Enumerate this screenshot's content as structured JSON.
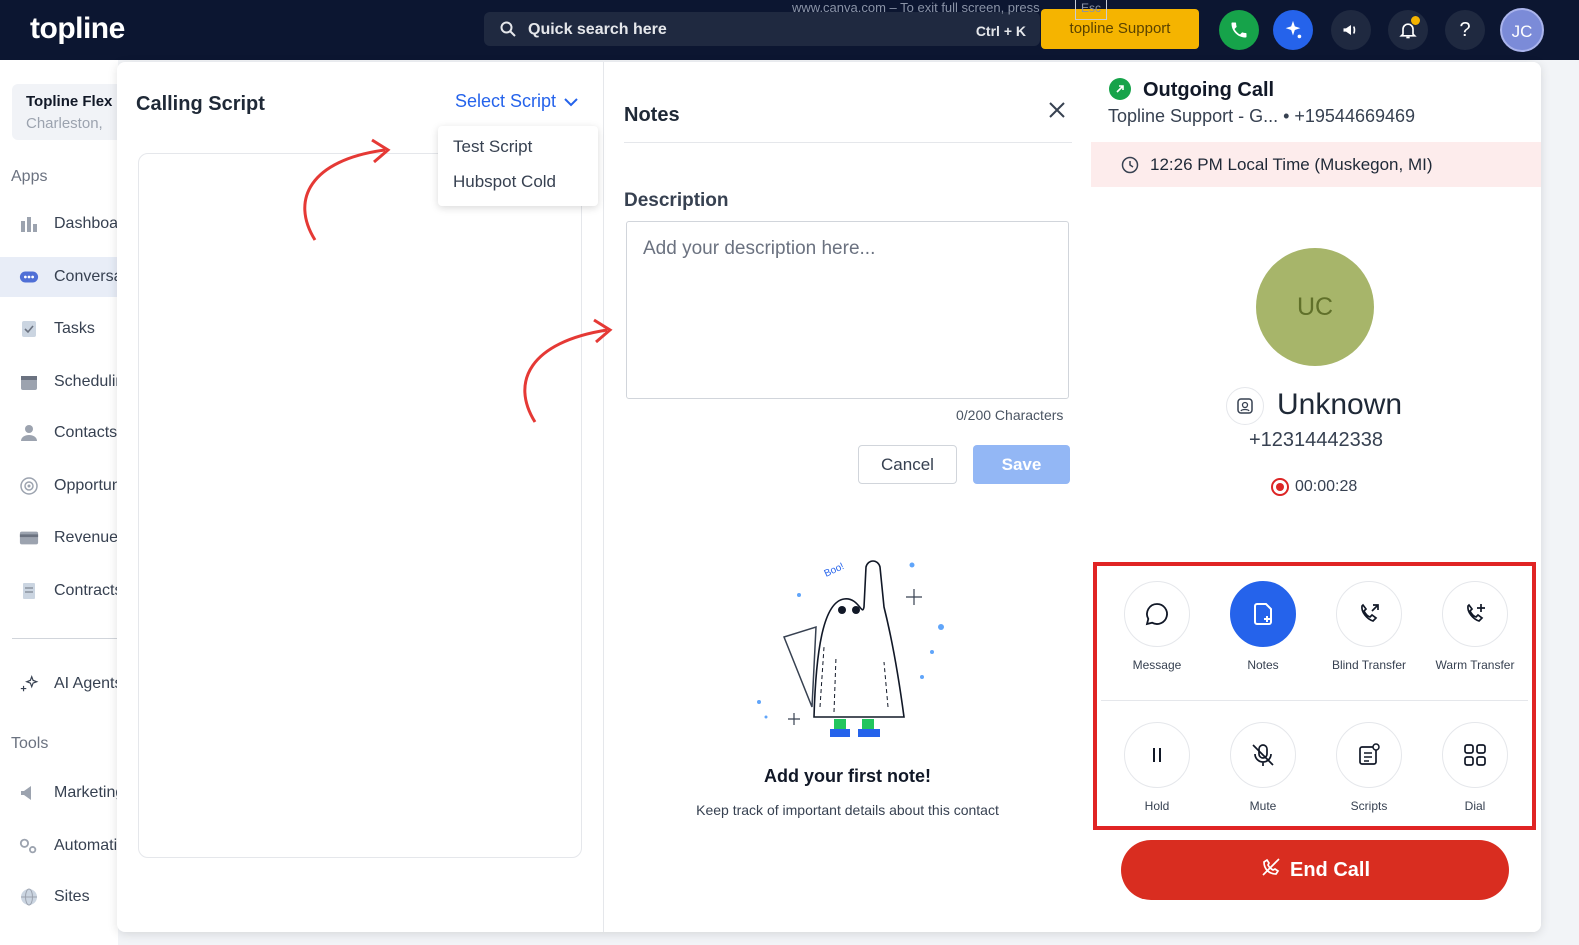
{
  "topbar": {
    "logo": "topline",
    "search_placeholder": "Quick search here",
    "search_shortcut": "Ctrl + K",
    "fullscreen_note": "www.canva.com – To exit full screen, press",
    "esc_key": "Esc",
    "support_button": "topline Support",
    "help_label": "?",
    "user_initials": "JC"
  },
  "sidebar": {
    "org_name": "Topline Flex",
    "org_location": "Charleston,",
    "apps_label": "Apps",
    "tools_label": "Tools",
    "items": [
      {
        "label": "Dashboard",
        "icon": "dashboard-icon"
      },
      {
        "label": "Conversations",
        "icon": "chat-icon",
        "active": true
      },
      {
        "label": "Tasks",
        "icon": "tasks-icon"
      },
      {
        "label": "Scheduling",
        "icon": "calendar-icon"
      },
      {
        "label": "Contacts",
        "icon": "person-icon"
      },
      {
        "label": "Opportunities",
        "icon": "target-icon"
      },
      {
        "label": "Revenue",
        "icon": "card-icon"
      },
      {
        "label": "Contracts",
        "icon": "document-icon"
      },
      {
        "label": "AI Agents",
        "icon": "sparkle-icon"
      }
    ],
    "tool_items": [
      {
        "label": "Marketing",
        "icon": "megaphone-icon"
      },
      {
        "label": "Automation",
        "icon": "gears-icon"
      },
      {
        "label": "Sites",
        "icon": "globe-icon"
      }
    ]
  },
  "script_panel": {
    "title": "Calling Script",
    "select_label": "Select Script",
    "options": [
      "Test Script",
      "Hubspot Cold"
    ]
  },
  "notes_panel": {
    "title": "Notes",
    "description_label": "Description",
    "description_placeholder": "Add your description here...",
    "char_count": "0/200 Characters",
    "cancel_label": "Cancel",
    "save_label": "Save",
    "empty_title": "Add your first note!",
    "empty_subtitle": "Keep track of important details about this contact",
    "ghost_text": "Boo!"
  },
  "call_panel": {
    "title": "Outgoing Call",
    "subtitle": "Topline Support - G... • +19544669469",
    "local_time": "12:26 PM Local Time (Muskegon, MI)",
    "avatar_initials": "UC",
    "caller_name": "Unknown",
    "caller_phone": "+12314442338",
    "timer": "00:00:28",
    "actions": [
      {
        "label": "Message",
        "icon": "message-icon"
      },
      {
        "label": "Notes",
        "icon": "notes-icon",
        "active": true
      },
      {
        "label": "Blind Transfer",
        "icon": "blind-transfer-icon"
      },
      {
        "label": "Warm Transfer",
        "icon": "warm-transfer-icon"
      },
      {
        "label": "Hold",
        "icon": "pause-icon"
      },
      {
        "label": "Mute",
        "icon": "mic-off-icon"
      },
      {
        "label": "Scripts",
        "icon": "script-icon"
      },
      {
        "label": "Dial",
        "icon": "grid-icon"
      }
    ],
    "end_call_label": "End Call"
  },
  "colors": {
    "topbar": "#0c1631",
    "accent": "#2563eb",
    "support": "#f5b400",
    "end_call": "#d92d20",
    "highlight_box": "#e02424",
    "arrow": "#e53935"
  }
}
